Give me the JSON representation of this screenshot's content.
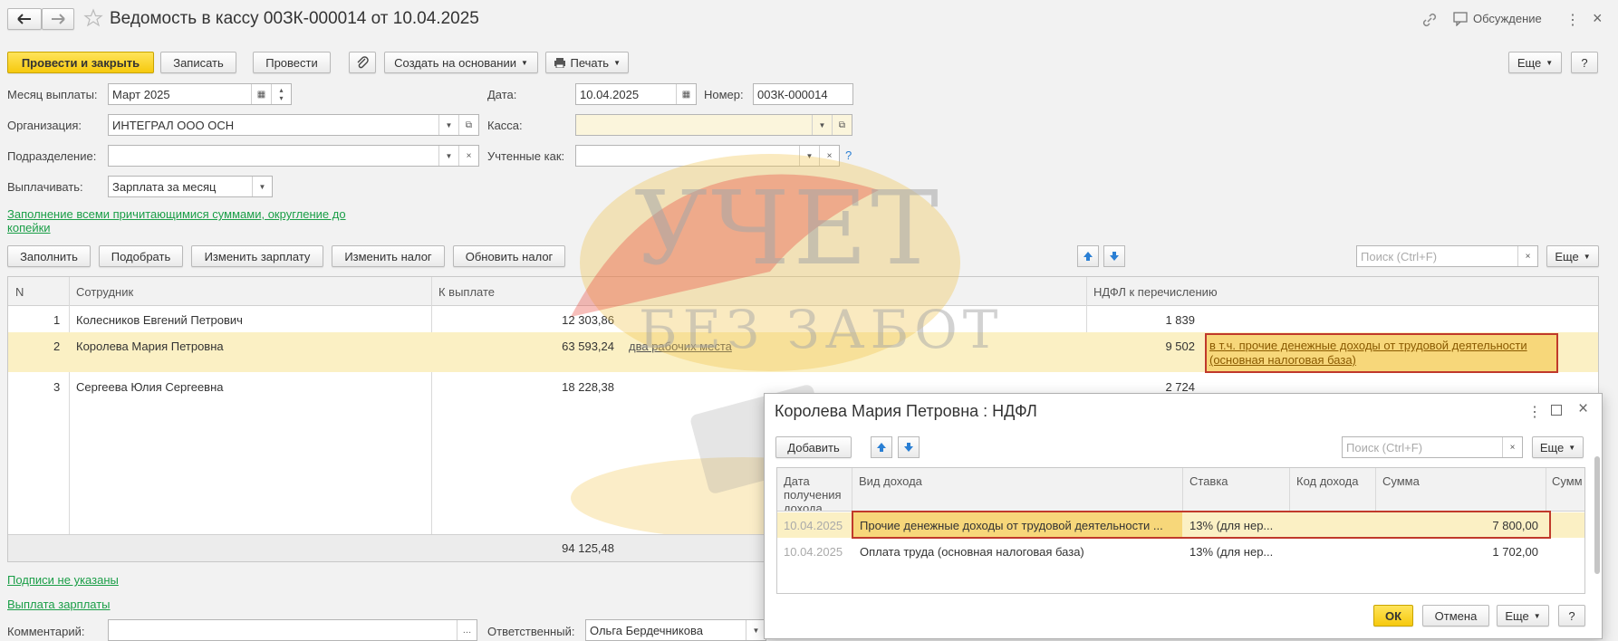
{
  "window": {
    "title": "Ведомость в кассу 00ЗК-000014 от 10.04.2025",
    "discuss_label": "Обсуждение"
  },
  "toolbar": {
    "post_close": "Провести и закрыть",
    "save": "Записать",
    "post": "Провести",
    "create_based": "Создать на основании",
    "print": "Печать",
    "more": "Еще",
    "help": "?"
  },
  "form": {
    "month_label": "Месяц выплаты:",
    "month_value": "Март 2025",
    "date_label": "Дата:",
    "date_value": "10.04.2025",
    "number_label": "Номер:",
    "number_value": "00ЗК-000014",
    "org_label": "Организация:",
    "org_value": "ИНТЕГРАЛ ООО ОСН",
    "cash_label": "Касса:",
    "cash_value": "",
    "dept_label": "Подразделение:",
    "dept_value": "",
    "accounted_label": "Учтенные как:",
    "accounted_value": "",
    "pay_label": "Выплачивать:",
    "pay_value": "Зарплата за месяц",
    "fill_link": "Заполнение всеми причитающимися суммами, округление до копейки"
  },
  "table_toolbar": {
    "fill": "Заполнить",
    "pick": "Подобрать",
    "change_salary": "Изменить зарплату",
    "change_tax": "Изменить налог",
    "update_tax": "Обновить налог",
    "search_placeholder": "Поиск (Ctrl+F)",
    "more": "Еще"
  },
  "table": {
    "headers": [
      "N",
      "Сотрудник",
      "К выплате",
      "НДФЛ к перечислению"
    ],
    "rows": [
      {
        "n": "1",
        "employee": "Колесников Евгений Петрович",
        "pay": "12 303,86",
        "extra": "",
        "tax": "1 839",
        "note": ""
      },
      {
        "n": "2",
        "employee": "Королева Мария Петровна",
        "pay": "63 593,24",
        "extra": "два рабочих места",
        "tax": "9 502",
        "note": "в т.ч. прочие денежные доходы от трудовой деятельности (основная налоговая база)"
      },
      {
        "n": "3",
        "employee": "Сергеева Юлия Сергеевна",
        "pay": "18 228,38",
        "extra": "",
        "tax": "2 724",
        "note": ""
      }
    ],
    "total_pay": "94 125,48"
  },
  "footer": {
    "signatures_link": "Подписи не указаны",
    "payout_link": "Выплата зарплаты",
    "comment_label": "Комментарий:",
    "responsible_label": "Ответственный:",
    "responsible_value": "Ольга Бердечникова"
  },
  "watermark": {
    "line1": "УЧЕТ",
    "line2": "БЕЗ ЗАБОТ"
  },
  "dialog": {
    "title": "Королева Мария Петровна : НДФЛ",
    "add": "Добавить",
    "search_placeholder": "Поиск (Ctrl+F)",
    "more": "Еще",
    "headers": [
      "Дата получения дохода",
      "Вид дохода",
      "Ставка",
      "Код дохода",
      "Сумма",
      "Сумм"
    ],
    "rows": [
      {
        "date": "10.04.2025",
        "type": "Прочие денежные доходы от трудовой деятельности ...",
        "rate": "13% (для нер...",
        "code": "",
        "sum": "7 800,00"
      },
      {
        "date": "10.04.2025",
        "type": "Оплата труда (основная налоговая база)",
        "rate": "13% (для нер...",
        "code": "",
        "sum": "1 702,00"
      }
    ],
    "ok": "ОК",
    "cancel": "Отмена",
    "help": "?"
  },
  "colors": {
    "accent_yellow": "#f6c90e",
    "link_green": "#1a9e47",
    "highlight_row": "#fbf0c4",
    "red_frame": "#c0392b"
  }
}
